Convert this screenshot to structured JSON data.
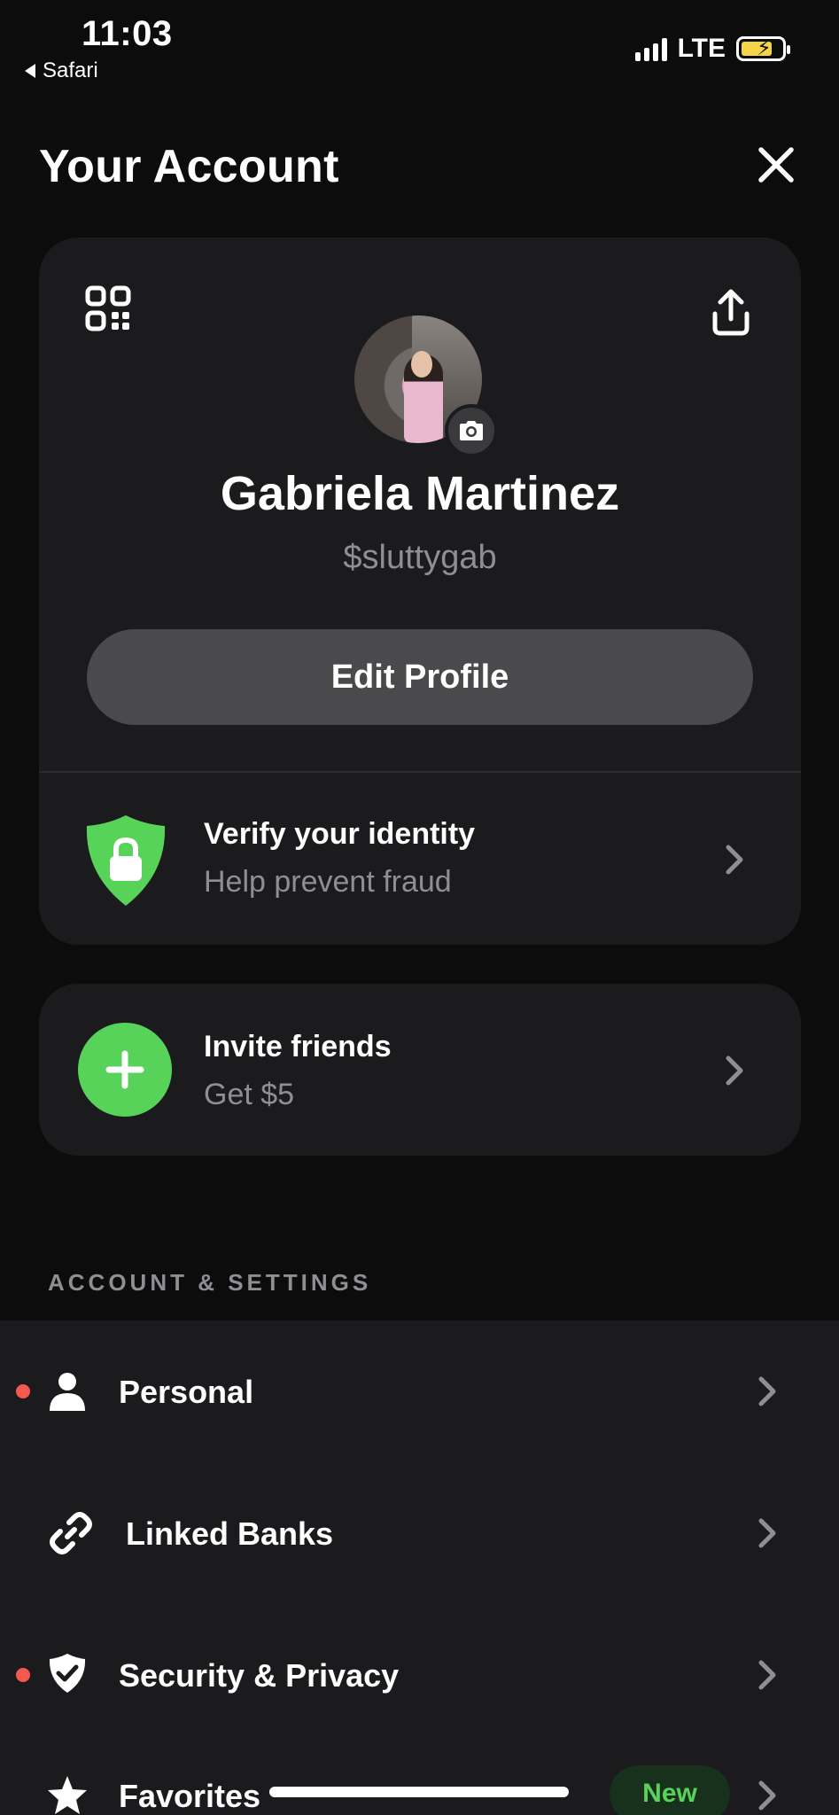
{
  "status_bar": {
    "time": "11:03",
    "back_app": "Safari",
    "network": "LTE"
  },
  "header": {
    "title": "Your Account"
  },
  "profile": {
    "name": "Gabriela Martinez",
    "cashtag": "$sluttygab",
    "edit_button": "Edit Profile"
  },
  "verify": {
    "title": "Verify your identity",
    "subtitle": "Help prevent fraud"
  },
  "invite": {
    "title": "Invite friends",
    "subtitle": "Get $5"
  },
  "settings": {
    "section_label": "ACCOUNT & SETTINGS",
    "items": [
      {
        "label": "Personal",
        "icon": "person-icon",
        "dot": true
      },
      {
        "label": "Linked Banks",
        "icon": "link-icon",
        "dot": false
      },
      {
        "label": "Security & Privacy",
        "icon": "shield-check-icon",
        "dot": true
      },
      {
        "label": "Favorites",
        "icon": "star-icon",
        "dot": false,
        "badge": "New"
      }
    ]
  },
  "colors": {
    "background": "#0c0c0d",
    "card": "#1b1b1e",
    "accent_green": "#58d35a",
    "alert_red": "#f4584e",
    "muted_text": "#8e8e93"
  }
}
